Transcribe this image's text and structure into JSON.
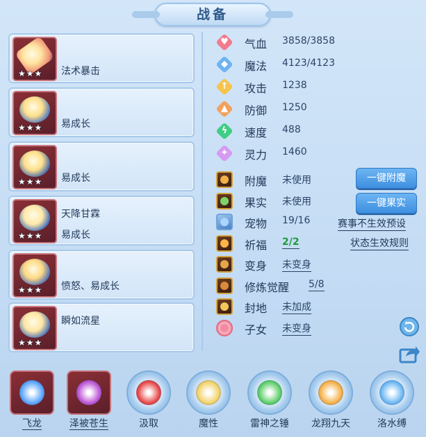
{
  "title": "战备",
  "equipment": [
    {
      "lines": [
        "法术暴击"
      ],
      "stars": 3,
      "icon": "popsicle-icon"
    },
    {
      "lines": [
        "易成长"
      ],
      "stars": 3,
      "icon": "helmet-icon"
    },
    {
      "lines": [
        "易成长"
      ],
      "stars": 3,
      "icon": "armor-icon"
    },
    {
      "lines": [
        "天降甘霖",
        "易成长"
      ],
      "stars": 3,
      "icon": "necklace-icon"
    },
    {
      "lines": [
        "愤怒、易成长"
      ],
      "stars": 3,
      "icon": "bracelet-icon"
    },
    {
      "lines": [
        "瞬如流星"
      ],
      "stars": 3,
      "icon": "boots-icon"
    }
  ],
  "stats": [
    {
      "label": "气血",
      "value": "3858/3858",
      "color": "#f27b8e",
      "glyph": "♥"
    },
    {
      "label": "魔法",
      "value": "4123/4123",
      "color": "#6fb3f0",
      "glyph": "◆"
    },
    {
      "label": "攻击",
      "value": "1238",
      "color": "#f6c44d",
      "glyph": "↑"
    },
    {
      "label": "防御",
      "value": "1250",
      "color": "#f2a25e",
      "glyph": "▲"
    },
    {
      "label": "速度",
      "value": "488",
      "color": "#3fce84",
      "glyph": "ϟ"
    },
    {
      "label": "灵力",
      "value": "1460",
      "color": "#d69bf0",
      "glyph": "✦"
    }
  ],
  "attrs": [
    {
      "label": "附魔",
      "value": "未使用",
      "underline": false
    },
    {
      "label": "果实",
      "value": "未使用",
      "underline": false
    },
    {
      "label": "宠物",
      "value": "19/16",
      "underline": false
    },
    {
      "label": "祈福",
      "value": "2/2",
      "underline": true,
      "highlight": true
    },
    {
      "label": "变身",
      "value": "未变身",
      "underline": true
    },
    {
      "label": "修炼觉醒",
      "value": "5/8",
      "underline": true
    },
    {
      "label": "封地",
      "value": "未加成",
      "underline": true
    },
    {
      "label": "子女",
      "value": "未变身",
      "underline": true
    }
  ],
  "buttons": {
    "enchant": "一键附魔",
    "fruit": "一键果实"
  },
  "links": {
    "preset": "赛事不生效预设",
    "rules": "状态生效规则"
  },
  "skills": [
    {
      "name": "飞龙",
      "style": "square",
      "underline": true
    },
    {
      "name": "泽被苍生",
      "style": "square",
      "underline": true
    },
    {
      "name": "汲取",
      "style": "ring",
      "underline": false
    },
    {
      "name": "魔性",
      "style": "ring",
      "underline": false
    },
    {
      "name": "雷神之锤",
      "style": "ring",
      "underline": false
    },
    {
      "name": "龙翔九天",
      "style": "ring",
      "underline": false
    },
    {
      "name": "洛水缚",
      "style": "ring",
      "underline": false
    }
  ],
  "colors": {
    "accent": "#3d8fe0",
    "panel": "#d2e5f8",
    "border": "#a7c8ea",
    "highlight": "#1e9a3a"
  }
}
